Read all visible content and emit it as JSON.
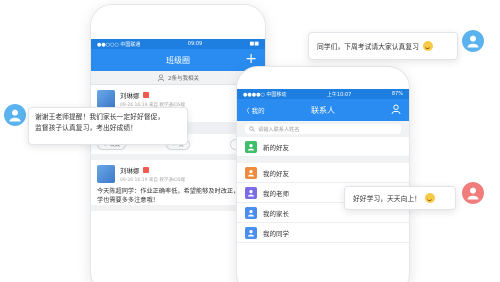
{
  "left_phone": {
    "status": {
      "carrier": "●●○○○ 中国联通",
      "time": "09:09",
      "battery": "■■"
    },
    "nav": {
      "title": "班级圈",
      "plus": "+"
    },
    "notice": "2条与我相关",
    "posts": [
      {
        "author": "刘琳娜",
        "meta": "09-26 16:19 来自 教学通iOS端",
        "text": "谢谢王老师提醒！我们家长一定好好督促，监督孩子认真复习，考出好成绩！",
        "actions": {
          "fav": "收藏",
          "like": "赞",
          "comment": "评论"
        }
      },
      {
        "author": "刘琳娜",
        "meta": "09-26 16:19 来自 教学通iOS端",
        "text": "今天陈超同学：作业正确率低，希望能够及时改正，其他同学也需要多多注意哦！"
      }
    ]
  },
  "right_phone": {
    "status": {
      "carrier": "●●●●○ 中国移动",
      "time": "上午10:07",
      "battery": "87%"
    },
    "nav": {
      "back": "〈 我的",
      "title": "联系人"
    },
    "search_placeholder": "请输入联系人姓名",
    "rows": [
      {
        "label": "新的好友",
        "color": "#3fbf6a"
      },
      {
        "label": "我的好友",
        "color": "#f08a3c"
      },
      {
        "label": "我的老师",
        "color": "#7b6be6"
      },
      {
        "label": "我的家长",
        "color": "#4a8ef0"
      },
      {
        "label": "我的同学",
        "color": "#4a8ef0"
      }
    ]
  },
  "bubbles": {
    "left_line1": "谢谢王老师提醒！我们家长一定好好督促，",
    "left_line2": "监督孩子认真复习，考出好成绩！",
    "top_right": "同学们，下周考试请大家认真复习",
    "bottom_right": "好好学习，天天向上！"
  },
  "colors": {
    "accent": "#2a8cf0",
    "avatar_blue": "#5ab2ee",
    "avatar_red": "#f07c7c"
  }
}
